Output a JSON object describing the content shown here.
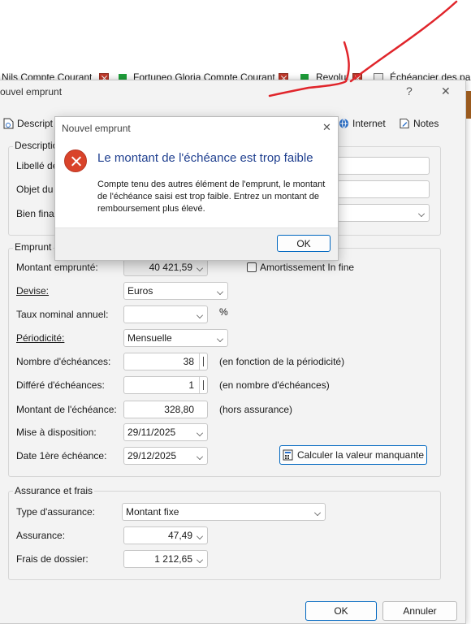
{
  "tabs_bar": [
    {
      "label": "Nils Compte Courant"
    },
    {
      "label": "Fortuneo Gloria Compte Courant"
    },
    {
      "label": "Revolut"
    },
    {
      "label": "Échéancier des paie"
    }
  ],
  "main_window": {
    "title": "ouvel emprunt",
    "help": "?",
    "close": "✕",
    "tabs": {
      "description": "Descript",
      "internet": "Internet",
      "notes": "Notes"
    }
  },
  "description_group": {
    "legend": "Descriptio",
    "libelle_label": "Libellé de",
    "objet_label": "Objet du",
    "bien_label": "Bien fina"
  },
  "emprunt_group": {
    "legend": "Emprunt",
    "montant_emprunte": {
      "label": "Montant emprunté:",
      "value": "40 421,59"
    },
    "amortissement": {
      "label": "Amortissement In fine",
      "checked": false
    },
    "devise": {
      "label": "Devise:",
      "value": "Euros"
    },
    "taux": {
      "label": "Taux nominal annuel:",
      "value": "",
      "unit": "%"
    },
    "periodicite": {
      "label": "Périodicité:",
      "value": "Mensuelle"
    },
    "nb_echeances": {
      "label": "Nombre d'échéances:",
      "value": "38",
      "hint": "(en fonction de la périodicité)"
    },
    "differe": {
      "label": "Différé d'échéances:",
      "value": "1",
      "hint": "(en nombre d'échéances)"
    },
    "montant_echeance": {
      "label": "Montant de l'échéance:",
      "value": "328,80",
      "hint": "(hors assurance)"
    },
    "mise_dispo": {
      "label": "Mise à disposition:",
      "value": "29/11/2025"
    },
    "date_premiere": {
      "label": "Date 1ère échéance:",
      "value": "29/12/2025"
    },
    "calc_button": "Calculer la valeur manquante"
  },
  "assurance_group": {
    "legend": "Assurance et frais",
    "type": {
      "label": "Type d'assurance:",
      "value": "Montant fixe"
    },
    "assurance": {
      "label": "Assurance:",
      "value": "47,49"
    },
    "frais": {
      "label": "Frais de dossier:",
      "value": "1 212,65"
    }
  },
  "footer": {
    "ok": "OK",
    "cancel": "Annuler"
  },
  "alert": {
    "title": "Nouvel emprunt",
    "close": "✕",
    "heading": "Le montant de l'échéance est trop faible",
    "body": "Compte tenu des autres élément de l'emprunt, le montant de l'échéance saisi est trop faible. Entrez un montant de remboursement plus élevé.",
    "ok": "OK"
  },
  "colors": {
    "accent": "#0067c0",
    "error": "#d9432a",
    "heading": "#1f3f8f",
    "scribble": "#e0252b"
  }
}
